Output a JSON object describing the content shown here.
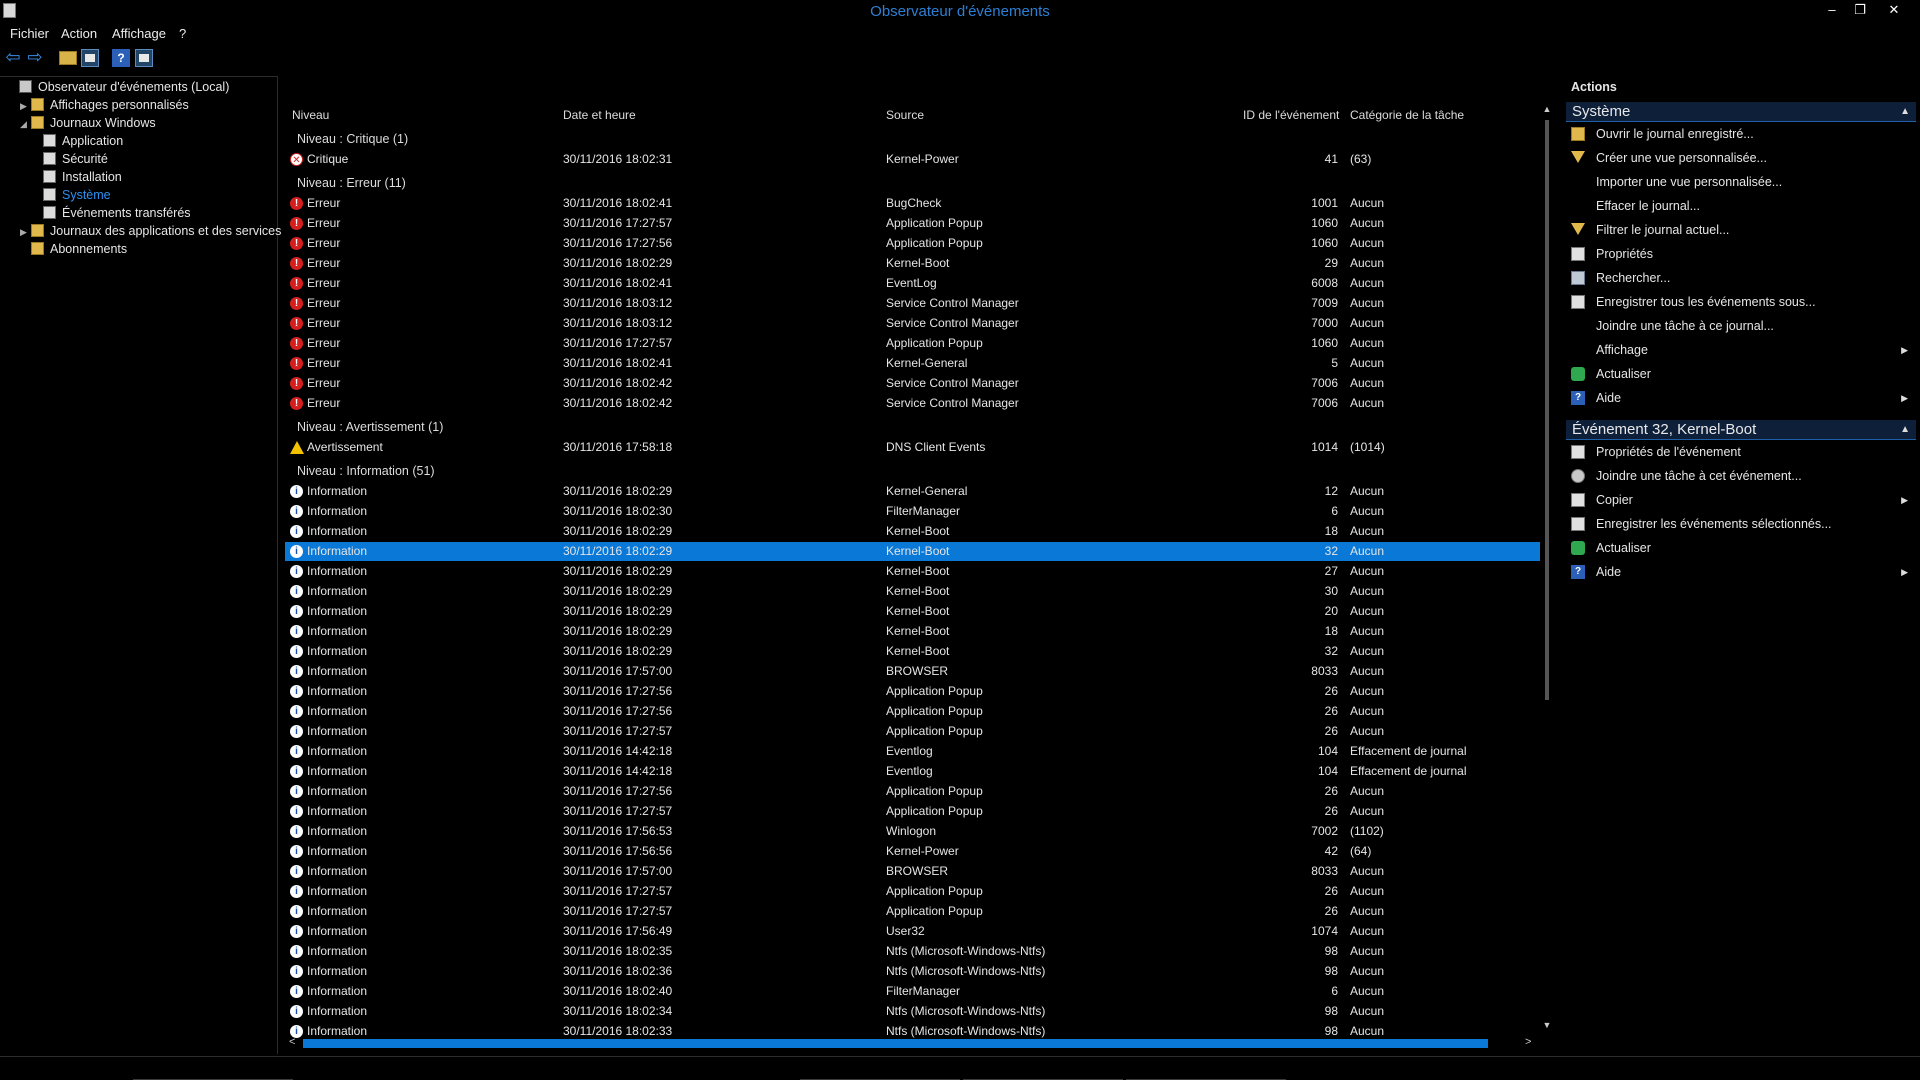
{
  "window": {
    "title": "Observateur d'événements",
    "minimize": "–",
    "restore": "❐",
    "close": "✕"
  },
  "menu": [
    "Fichier",
    "Action",
    "Affichage",
    "?"
  ],
  "tree": [
    {
      "label": "Observateur d'événements (Local)",
      "indent": 0,
      "expander": "",
      "icon": "root"
    },
    {
      "label": "Affichages personnalisés",
      "indent": 1,
      "expander": "▶",
      "icon": "folder"
    },
    {
      "label": "Journaux Windows",
      "indent": 1,
      "expander": "◢",
      "icon": "folder"
    },
    {
      "label": "Application",
      "indent": 2,
      "expander": "",
      "icon": "log"
    },
    {
      "label": "Sécurité",
      "indent": 2,
      "expander": "",
      "icon": "log"
    },
    {
      "label": "Installation",
      "indent": 2,
      "expander": "",
      "icon": "log"
    },
    {
      "label": "Système",
      "indent": 2,
      "expander": "",
      "icon": "log",
      "active": true
    },
    {
      "label": "Événements transférés",
      "indent": 2,
      "expander": "",
      "icon": "log"
    },
    {
      "label": "Journaux des applications et des services",
      "indent": 1,
      "expander": "▶",
      "icon": "folder"
    },
    {
      "label": "Abonnements",
      "indent": 1,
      "expander": "",
      "icon": "subs"
    }
  ],
  "columns": {
    "level": "Niveau",
    "date": "Date et heure",
    "source": "Source",
    "id": "ID de l'événement",
    "category": "Catégorie de la tâche"
  },
  "groups": [
    {
      "title": "Niveau : Critique (1)",
      "rows": [
        {
          "type": "critical",
          "level": "Critique",
          "date": "30/11/2016 18:02:31",
          "source": "Kernel-Power",
          "id": "41",
          "category": "(63)"
        }
      ]
    },
    {
      "title": "Niveau : Erreur (11)",
      "rows": [
        {
          "type": "error",
          "level": "Erreur",
          "date": "30/11/2016 18:02:41",
          "source": "BugCheck",
          "id": "1001",
          "category": "Aucun"
        },
        {
          "type": "error",
          "level": "Erreur",
          "date": "30/11/2016 17:27:57",
          "source": "Application Popup",
          "id": "1060",
          "category": "Aucun"
        },
        {
          "type": "error",
          "level": "Erreur",
          "date": "30/11/2016 17:27:56",
          "source": "Application Popup",
          "id": "1060",
          "category": "Aucun"
        },
        {
          "type": "error",
          "level": "Erreur",
          "date": "30/11/2016 18:02:29",
          "source": "Kernel-Boot",
          "id": "29",
          "category": "Aucun"
        },
        {
          "type": "error",
          "level": "Erreur",
          "date": "30/11/2016 18:02:41",
          "source": "EventLog",
          "id": "6008",
          "category": "Aucun"
        },
        {
          "type": "error",
          "level": "Erreur",
          "date": "30/11/2016 18:03:12",
          "source": "Service Control Manager",
          "id": "7009",
          "category": "Aucun"
        },
        {
          "type": "error",
          "level": "Erreur",
          "date": "30/11/2016 18:03:12",
          "source": "Service Control Manager",
          "id": "7000",
          "category": "Aucun"
        },
        {
          "type": "error",
          "level": "Erreur",
          "date": "30/11/2016 17:27:57",
          "source": "Application Popup",
          "id": "1060",
          "category": "Aucun"
        },
        {
          "type": "error",
          "level": "Erreur",
          "date": "30/11/2016 18:02:41",
          "source": "Kernel-General",
          "id": "5",
          "category": "Aucun"
        },
        {
          "type": "error",
          "level": "Erreur",
          "date": "30/11/2016 18:02:42",
          "source": "Service Control Manager",
          "id": "7006",
          "category": "Aucun"
        },
        {
          "type": "error",
          "level": "Erreur",
          "date": "30/11/2016 18:02:42",
          "source": "Service Control Manager",
          "id": "7006",
          "category": "Aucun"
        }
      ]
    },
    {
      "title": "Niveau : Avertissement (1)",
      "rows": [
        {
          "type": "warning",
          "level": "Avertissement",
          "date": "30/11/2016 17:58:18",
          "source": "DNS Client Events",
          "id": "1014",
          "category": "(1014)"
        }
      ]
    },
    {
      "title": "Niveau : Information (51)",
      "rows": [
        {
          "type": "info",
          "level": "Information",
          "date": "30/11/2016 18:02:29",
          "source": "Kernel-General",
          "id": "12",
          "category": "Aucun"
        },
        {
          "type": "info",
          "level": "Information",
          "date": "30/11/2016 18:02:30",
          "source": "FilterManager",
          "id": "6",
          "category": "Aucun"
        },
        {
          "type": "info",
          "level": "Information",
          "date": "30/11/2016 18:02:29",
          "source": "Kernel-Boot",
          "id": "18",
          "category": "Aucun"
        },
        {
          "type": "info",
          "level": "Information",
          "date": "30/11/2016 18:02:29",
          "source": "Kernel-Boot",
          "id": "32",
          "category": "Aucun",
          "selected": true
        },
        {
          "type": "info",
          "level": "Information",
          "date": "30/11/2016 18:02:29",
          "source": "Kernel-Boot",
          "id": "27",
          "category": "Aucun"
        },
        {
          "type": "info",
          "level": "Information",
          "date": "30/11/2016 18:02:29",
          "source": "Kernel-Boot",
          "id": "30",
          "category": "Aucun"
        },
        {
          "type": "info",
          "level": "Information",
          "date": "30/11/2016 18:02:29",
          "source": "Kernel-Boot",
          "id": "20",
          "category": "Aucun"
        },
        {
          "type": "info",
          "level": "Information",
          "date": "30/11/2016 18:02:29",
          "source": "Kernel-Boot",
          "id": "18",
          "category": "Aucun"
        },
        {
          "type": "info",
          "level": "Information",
          "date": "30/11/2016 18:02:29",
          "source": "Kernel-Boot",
          "id": "32",
          "category": "Aucun"
        },
        {
          "type": "info",
          "level": "Information",
          "date": "30/11/2016 17:57:00",
          "source": "BROWSER",
          "id": "8033",
          "category": "Aucun"
        },
        {
          "type": "info",
          "level": "Information",
          "date": "30/11/2016 17:27:56",
          "source": "Application Popup",
          "id": "26",
          "category": "Aucun"
        },
        {
          "type": "info",
          "level": "Information",
          "date": "30/11/2016 17:27:56",
          "source": "Application Popup",
          "id": "26",
          "category": "Aucun"
        },
        {
          "type": "info",
          "level": "Information",
          "date": "30/11/2016 17:27:57",
          "source": "Application Popup",
          "id": "26",
          "category": "Aucun"
        },
        {
          "type": "info",
          "level": "Information",
          "date": "30/11/2016 14:42:18",
          "source": "Eventlog",
          "id": "104",
          "category": "Effacement de journal"
        },
        {
          "type": "info",
          "level": "Information",
          "date": "30/11/2016 14:42:18",
          "source": "Eventlog",
          "id": "104",
          "category": "Effacement de journal"
        },
        {
          "type": "info",
          "level": "Information",
          "date": "30/11/2016 17:27:56",
          "source": "Application Popup",
          "id": "26",
          "category": "Aucun"
        },
        {
          "type": "info",
          "level": "Information",
          "date": "30/11/2016 17:27:57",
          "source": "Application Popup",
          "id": "26",
          "category": "Aucun"
        },
        {
          "type": "info",
          "level": "Information",
          "date": "30/11/2016 17:56:53",
          "source": "Winlogon",
          "id": "7002",
          "category": "(1102)"
        },
        {
          "type": "info",
          "level": "Information",
          "date": "30/11/2016 17:56:56",
          "source": "Kernel-Power",
          "id": "42",
          "category": "(64)"
        },
        {
          "type": "info",
          "level": "Information",
          "date": "30/11/2016 17:57:00",
          "source": "BROWSER",
          "id": "8033",
          "category": "Aucun"
        },
        {
          "type": "info",
          "level": "Information",
          "date": "30/11/2016 17:27:57",
          "source": "Application Popup",
          "id": "26",
          "category": "Aucun"
        },
        {
          "type": "info",
          "level": "Information",
          "date": "30/11/2016 17:27:57",
          "source": "Application Popup",
          "id": "26",
          "category": "Aucun"
        },
        {
          "type": "info",
          "level": "Information",
          "date": "30/11/2016 17:56:49",
          "source": "User32",
          "id": "1074",
          "category": "Aucun"
        },
        {
          "type": "info",
          "level": "Information",
          "date": "30/11/2016 18:02:35",
          "source": "Ntfs (Microsoft-Windows-Ntfs)",
          "id": "98",
          "category": "Aucun"
        },
        {
          "type": "info",
          "level": "Information",
          "date": "30/11/2016 18:02:36",
          "source": "Ntfs (Microsoft-Windows-Ntfs)",
          "id": "98",
          "category": "Aucun"
        },
        {
          "type": "info",
          "level": "Information",
          "date": "30/11/2016 18:02:40",
          "source": "FilterManager",
          "id": "6",
          "category": "Aucun"
        },
        {
          "type": "info",
          "level": "Information",
          "date": "30/11/2016 18:02:34",
          "source": "Ntfs (Microsoft-Windows-Ntfs)",
          "id": "98",
          "category": "Aucun"
        },
        {
          "type": "info",
          "level": "Information",
          "date": "30/11/2016 18:02:33",
          "source": "Ntfs (Microsoft-Windows-Ntfs)",
          "id": "98",
          "category": "Aucun"
        }
      ]
    }
  ],
  "actions": {
    "title": "Actions",
    "sections": [
      {
        "header": "Système",
        "items": [
          {
            "label": "Ouvrir le journal enregistré...",
            "icon": "folder"
          },
          {
            "label": "Créer une vue personnalisée...",
            "icon": "filter"
          },
          {
            "label": "Importer une vue personnalisée...",
            "icon": ""
          },
          {
            "label": "Effacer le journal...",
            "icon": ""
          },
          {
            "label": "Filtrer le journal actuel...",
            "icon": "filter"
          },
          {
            "label": "Propriétés",
            "icon": "doc"
          },
          {
            "label": "Rechercher...",
            "icon": "find"
          },
          {
            "label": "Enregistrer tous les événements sous...",
            "icon": "doc"
          },
          {
            "label": "Joindre une tâche à ce journal...",
            "icon": ""
          },
          {
            "label": "Affichage",
            "icon": "",
            "submenu": true
          },
          {
            "label": "Actualiser",
            "icon": "refresh"
          },
          {
            "label": "Aide",
            "icon": "help",
            "submenu": true
          }
        ]
      },
      {
        "header": "Événement 32, Kernel-Boot",
        "items": [
          {
            "label": "Propriétés de l'événement",
            "icon": "doc"
          },
          {
            "label": "Joindre une tâche à cet événement...",
            "icon": "task"
          },
          {
            "label": "Copier",
            "icon": "doc",
            "submenu": true
          },
          {
            "label": "Enregistrer les événements sélectionnés...",
            "icon": "doc"
          },
          {
            "label": "Actualiser",
            "icon": "refresh"
          },
          {
            "label": "Aide",
            "icon": "help",
            "submenu": true
          }
        ]
      }
    ]
  },
  "colors": {
    "accent": "#0a78d7",
    "title": "#2d7fd3",
    "background": "#000000"
  }
}
